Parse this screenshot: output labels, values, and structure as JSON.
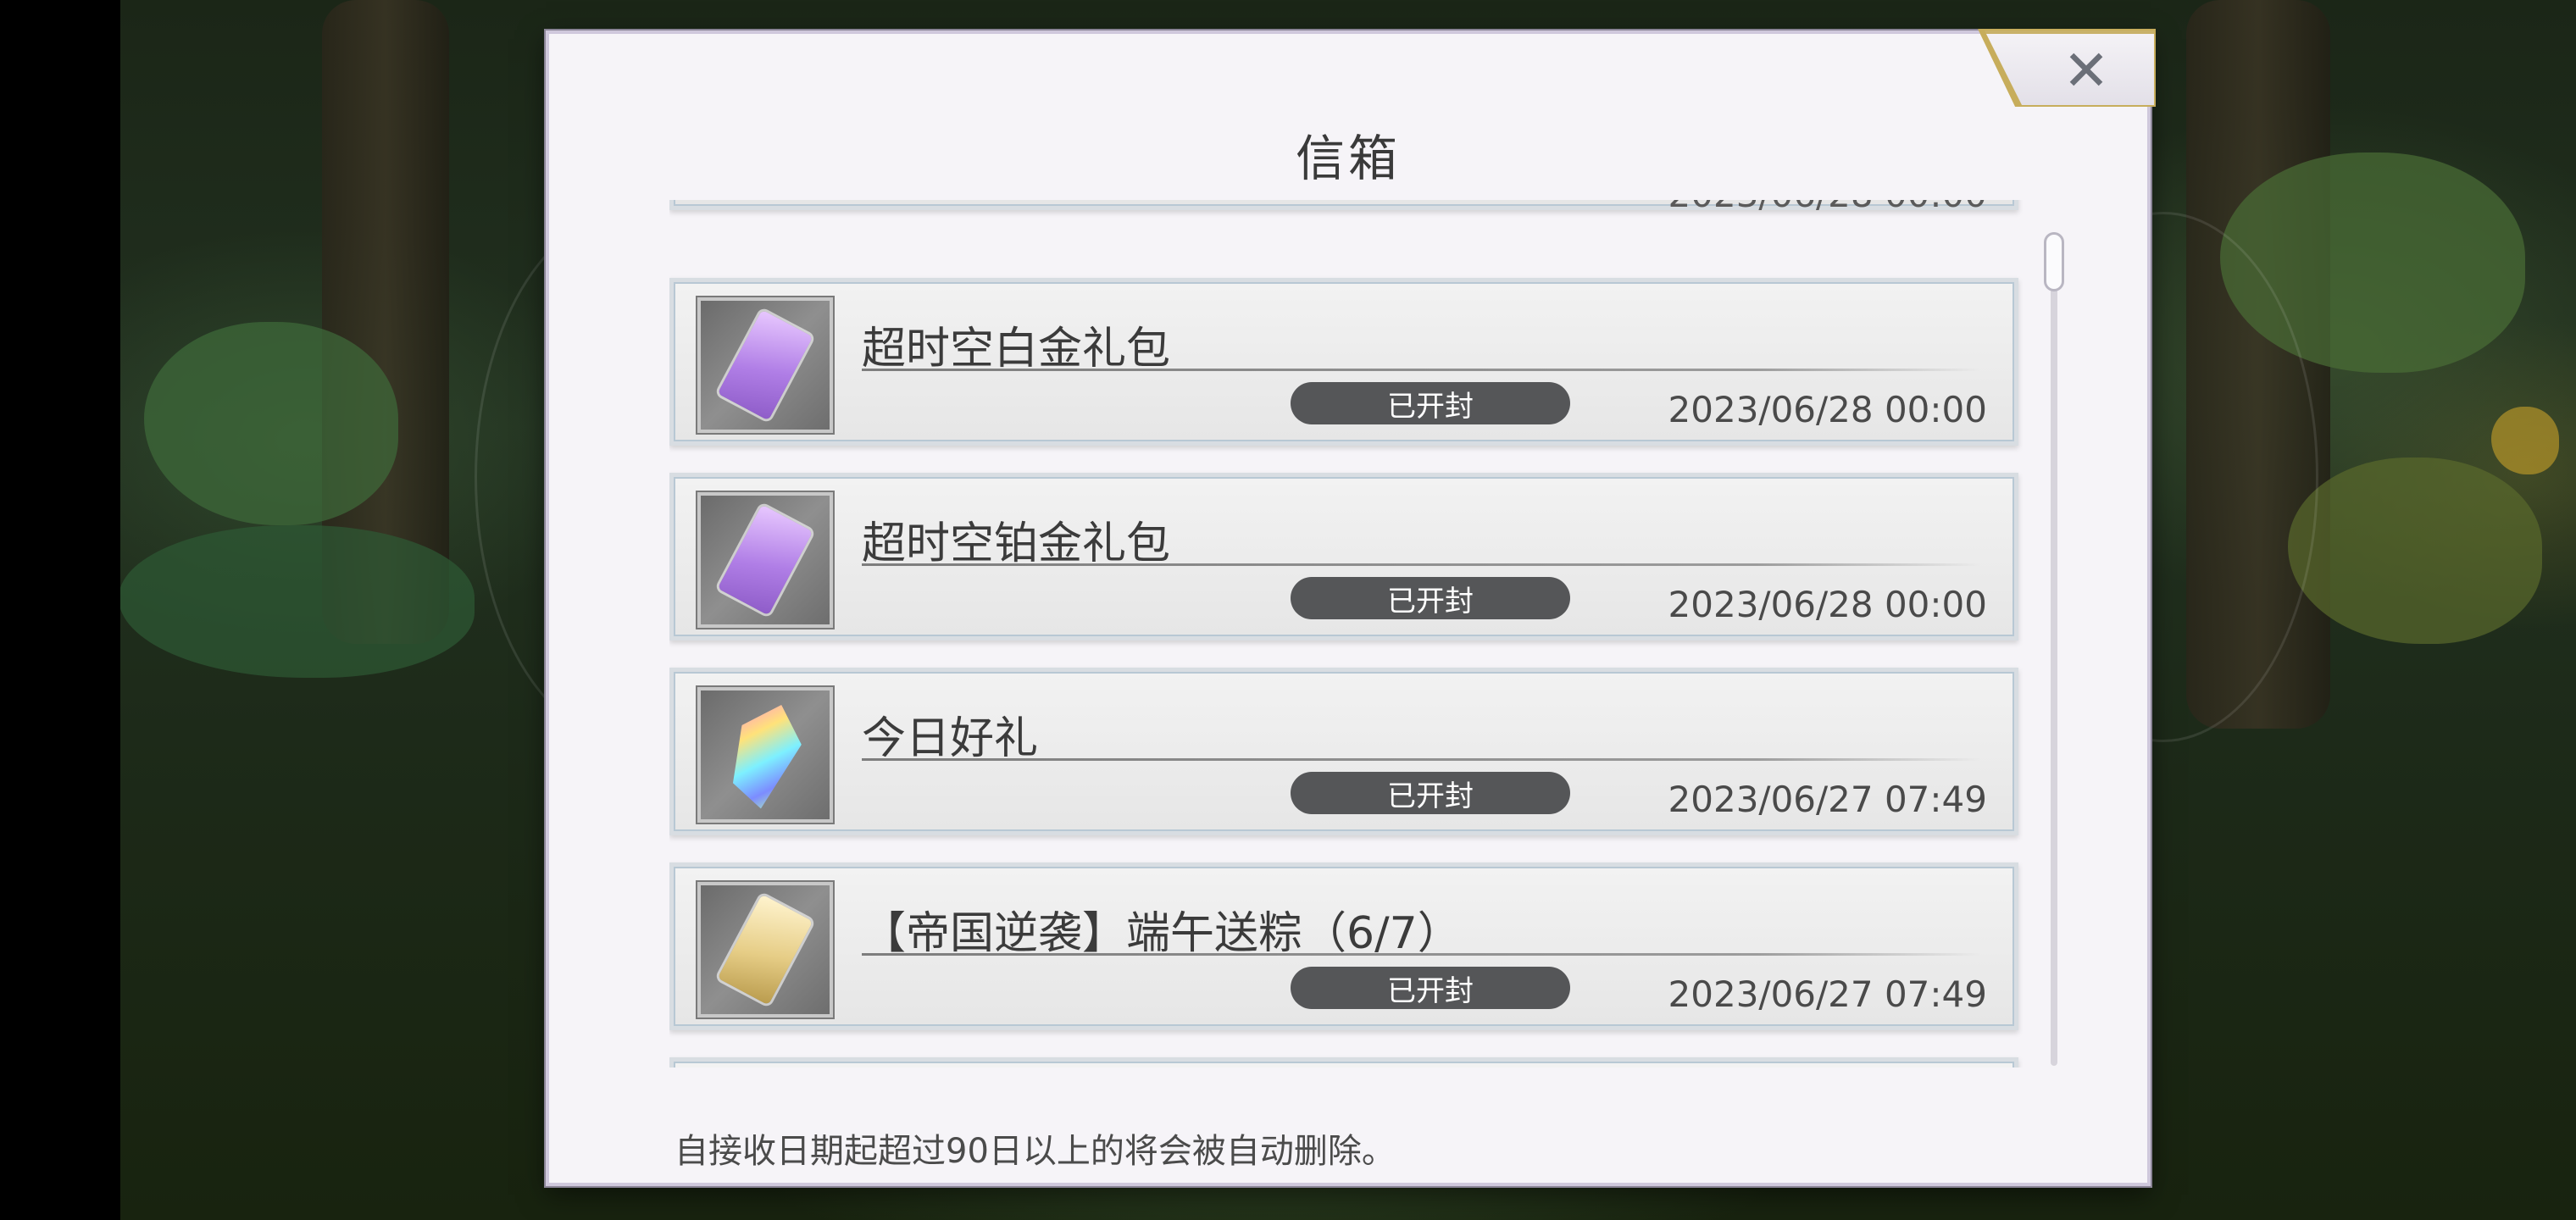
{
  "window": {
    "title": "信箱"
  },
  "close": {
    "glyph": "✕"
  },
  "mails": [
    {
      "title": "超时空白金礼包",
      "status": "已开封",
      "date": "2023/06/28 00:00",
      "icon": "purple-ticket-icon"
    },
    {
      "title": "超时空铂金礼包",
      "status": "已开封",
      "date": "2023/06/28 00:00",
      "icon": "purple-ticket-icon"
    },
    {
      "title": "今日好礼",
      "status": "已开封",
      "date": "2023/06/27 07:49",
      "icon": "rainbow-crystal-icon"
    },
    {
      "title": "【帝国逆袭】端午送粽（6/7）",
      "status": "已开封",
      "date": "2023/06/27 07:49",
      "icon": "gold-ticket-icon"
    }
  ],
  "partial_top_date": "2023/06/28 00:00",
  "footer": {
    "note": "自接收日期起超过90日以上的将会被自动删除。"
  },
  "colors": {
    "badge": "#555658",
    "accent_gold": "#c7ad5c",
    "panel": "#f6f4f8"
  }
}
